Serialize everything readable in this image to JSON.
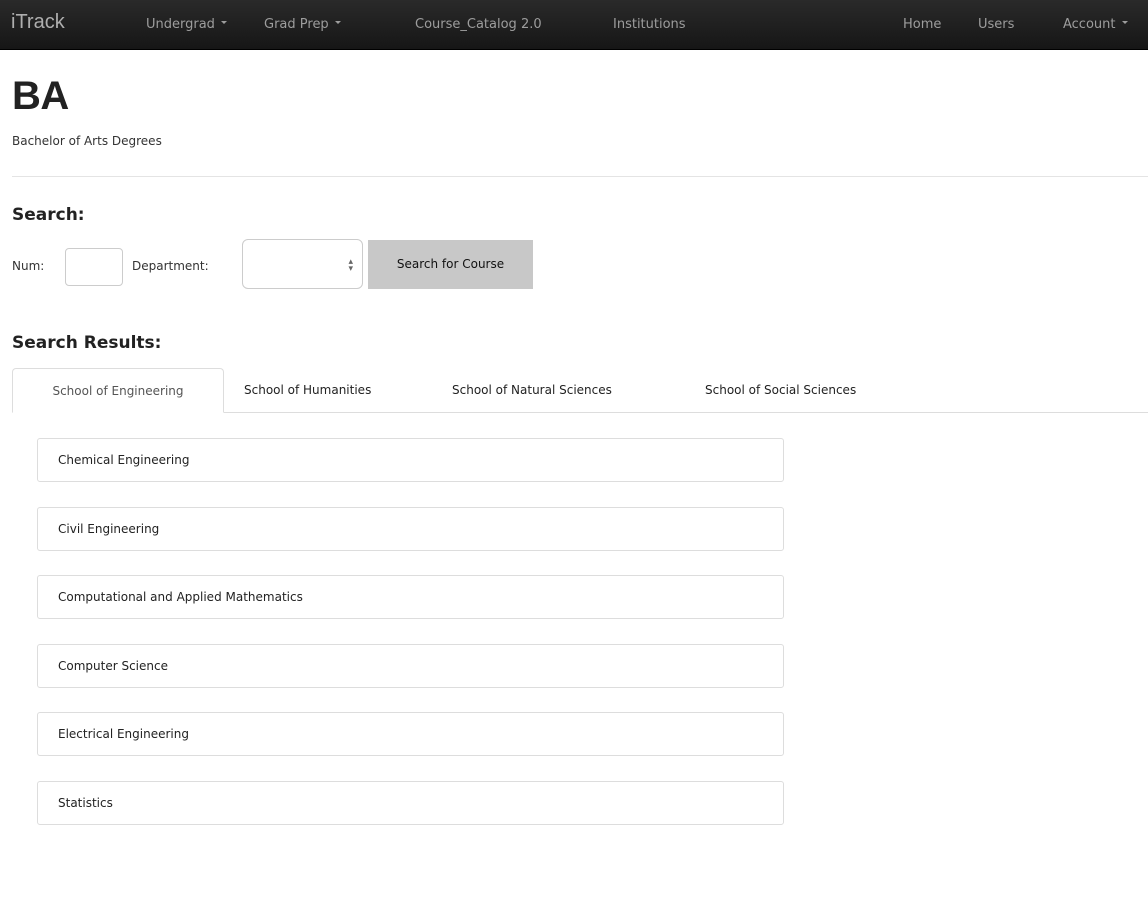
{
  "navbar": {
    "brand": "iTrack",
    "items": [
      {
        "label": "Undergrad",
        "dropdown": true
      },
      {
        "label": "Grad Prep",
        "dropdown": true
      },
      {
        "label": "Course_Catalog 2.0",
        "dropdown": false
      },
      {
        "label": "Institutions",
        "dropdown": false
      }
    ],
    "right_items": [
      {
        "label": "Home",
        "dropdown": false
      },
      {
        "label": "Users",
        "dropdown": false
      },
      {
        "label": "Account",
        "dropdown": true
      }
    ]
  },
  "header": {
    "title": "BA",
    "subtitle": "Bachelor of Arts Degrees"
  },
  "search": {
    "heading": "Search:",
    "num_label": "Num:",
    "num_value": "",
    "department_label": "Department:",
    "department_selected": "",
    "button_label": "Search for Course"
  },
  "results": {
    "heading": "Search Results:",
    "tabs": [
      {
        "label": "School of Engineering",
        "active": true
      },
      {
        "label": "School of Humanities",
        "active": false
      },
      {
        "label": "School of Natural Sciences",
        "active": false
      },
      {
        "label": "School of Social Sciences",
        "active": false
      }
    ],
    "departments": [
      "Chemical Engineering",
      "Civil Engineering",
      "Computational and Applied Mathematics",
      "Computer Science",
      "Electrical Engineering",
      "Statistics"
    ]
  }
}
